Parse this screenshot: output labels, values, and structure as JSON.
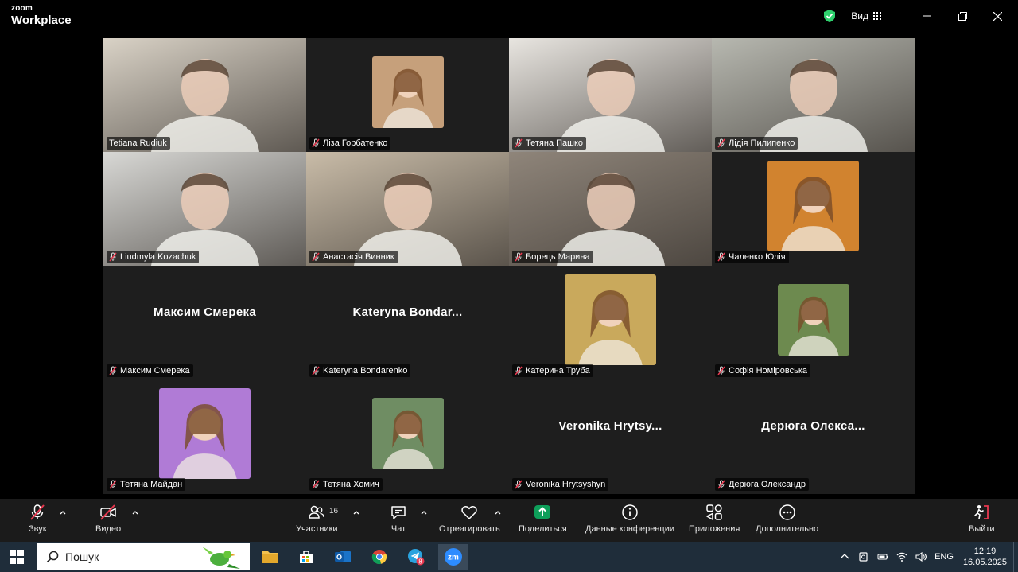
{
  "app": {
    "brand_top": "zoom",
    "brand_bottom": "Workplace",
    "view_label": "Вид"
  },
  "participants": [
    {
      "name": "Tetiana Rudiuk",
      "mode": "video",
      "muted": false,
      "active": true,
      "bg": "#d9d2c6"
    },
    {
      "name": "Ліза Горбатенко",
      "mode": "avatar",
      "muted": true,
      "bg": "#c6a07b"
    },
    {
      "name": "Тетяна Пашко",
      "mode": "video",
      "muted": true,
      "bg": "#e8e5e0"
    },
    {
      "name": "Лідія Пилипенко",
      "mode": "video",
      "muted": true,
      "bg": "#b7b8b0"
    },
    {
      "name": "Liudmyla Kozachuk",
      "mode": "video",
      "muted": true,
      "bg": "#d8d8d5"
    },
    {
      "name": "Анастасія Винник",
      "mode": "video",
      "muted": true,
      "bg": "#c9bca8"
    },
    {
      "name": "Борець Марина",
      "mode": "video",
      "muted": true,
      "bg": "#8f857a"
    },
    {
      "name": "Чаленко Юлія",
      "mode": "avatar",
      "muted": true,
      "bg": "#d1832f"
    },
    {
      "name": "Максим Смерека",
      "mode": "name",
      "display": "Максим Смерека",
      "muted": true
    },
    {
      "name": "Kateryna Bondarenko",
      "mode": "name",
      "display": "Kateryna Bondar...",
      "muted": true
    },
    {
      "name": "Катерина Труба",
      "mode": "avatar",
      "muted": true,
      "bg": "#c9a95c"
    },
    {
      "name": "Софія Номіровська",
      "mode": "avatar",
      "muted": true,
      "bg": "#6d8a4f"
    },
    {
      "name": "Тетяна Майдан",
      "mode": "avatar",
      "muted": true,
      "bg": "#b07bd6"
    },
    {
      "name": "Тетяна Хомич",
      "mode": "avatar",
      "muted": true,
      "bg": "#6f8d63"
    },
    {
      "name": "Veronika Hrytsyshyn",
      "mode": "name",
      "display": "Veronika Hrytsy...",
      "muted": true
    },
    {
      "name": "Дерюга Олександр",
      "mode": "name",
      "display": "Дерюга Олекса...",
      "muted": true
    }
  ],
  "controls": {
    "audio": "Звук",
    "video": "Видео",
    "participants": "Участники",
    "participants_count": "16",
    "chat": "Чат",
    "react": "Отреагировать",
    "share": "Поделиться",
    "info": "Данные конференции",
    "apps": "Приложения",
    "more": "Дополнительно",
    "leave": "Выйти"
  },
  "colors": {
    "accent_green": "#2fd16e",
    "share_green": "#0e9f5a",
    "mute_red": "#e8384f"
  },
  "taskbar": {
    "search_placeholder": "Пошук",
    "lang": "ENG",
    "time": "12:19",
    "date": "16.05.2025",
    "telegram_badge": "8"
  }
}
